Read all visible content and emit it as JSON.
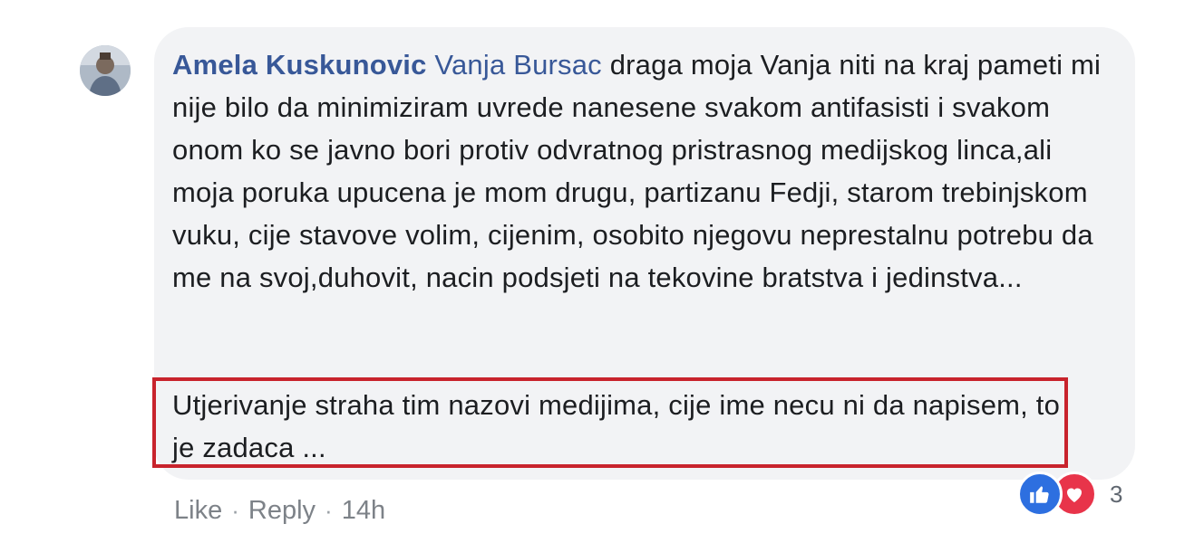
{
  "comment": {
    "author": "Amela Kuskunovic",
    "mention": "Vanja Bursac",
    "body": "draga moja Vanja niti na kraj pameti mi nije bilo da minimiziram uvrede nanesene svakom antifasisti i svakom onom ko se javno bori protiv odvratnog pristrasnog medijskog linca,ali moja poruka upucena je mom drugu, partizanu Fedji, starom trebinjskom vuku, cije stavove volim, cijenim, osobito njegovu neprestalnu potrebu da me na svoj,duhovit, nacin podsjeti na tekovine bratstva i jedinstva...",
    "highlighted": "Utjerivanje straha tim nazovi medijima, cije ime necu ni da napisem, to je zadaca ...",
    "reactions": {
      "count": "3",
      "icons": [
        "like-icon",
        "love-icon"
      ]
    },
    "actions": {
      "like": "Like",
      "reply": "Reply",
      "separator": "·",
      "time": "14h"
    }
  },
  "colors": {
    "author": "#385898",
    "bubble": "#f2f3f5",
    "highlight_border": "#c8232c",
    "like": "#2d6fe0",
    "love": "#e8344a"
  }
}
